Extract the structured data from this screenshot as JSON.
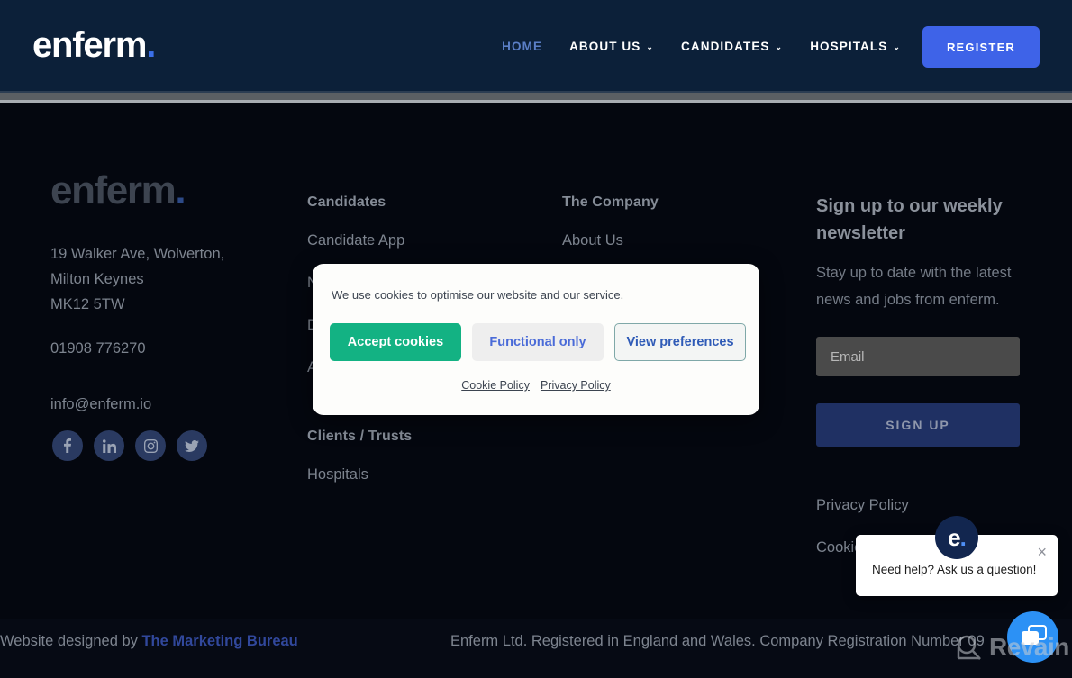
{
  "header": {
    "logo": "enferm",
    "logo_dot": ".",
    "nav": [
      {
        "label": "HOME",
        "caret": "",
        "active": true
      },
      {
        "label": "ABOUT US",
        "caret": "⌄",
        "active": false
      },
      {
        "label": "CANDIDATES",
        "caret": "⌄",
        "active": false
      },
      {
        "label": "HOSPITALS",
        "caret": "⌄",
        "active": false
      }
    ],
    "register_label": "REGISTER"
  },
  "footer": {
    "logo": "enferm",
    "logo_dot": ".",
    "address": "19 Walker Ave, Wolverton,\nMilton Keynes\nMK12 5TW",
    "phone": "01908 776270",
    "email": "info@enferm.io",
    "socials": [
      {
        "name": "facebook-icon"
      },
      {
        "name": "linkedin-icon"
      },
      {
        "name": "instagram-icon"
      },
      {
        "name": "twitter-icon"
      }
    ],
    "columns": {
      "candidates": {
        "title": "Candidates",
        "links": [
          "Candidate App",
          "Nurses",
          "Doctors",
          "AHP"
        ]
      },
      "company": {
        "title": "The Company",
        "links": [
          "About Us"
        ]
      },
      "clients": {
        "title": "Clients / Trusts",
        "links": [
          "Hospitals"
        ]
      }
    },
    "newsletter": {
      "title": "Sign up to our weekly newsletter",
      "body": "Stay up to date with the latest news and jobs from enferm.",
      "email_placeholder": "Email",
      "email_value": "",
      "signup_label": "SIGN UP"
    },
    "legal": [
      "Privacy Policy",
      "Cookie Policy"
    ]
  },
  "bottom_bar": {
    "designed_prefix": "Website designed by ",
    "designer": "The Marketing Bureau",
    "registration": "Enferm Ltd. Registered in England and Wales. Company Registration Number 09"
  },
  "cookie_dialog": {
    "message": "We use cookies to optimise our website and our service.",
    "buttons": {
      "accept": "Accept cookies",
      "functional": "Functional only",
      "preferences": "View preferences"
    },
    "links": [
      "Cookie Policy",
      "Privacy Policy"
    ],
    "colors": {
      "accept_bg": "#13b283",
      "functional_bg": "#eeeeee",
      "link_color": "#2f5bb7"
    }
  },
  "chat_widget": {
    "avatar_letter": "e",
    "avatar_dot": ".",
    "message": "Need help? Ask us a question!",
    "close_icon": "×"
  },
  "watermark": {
    "text": "Revain"
  },
  "colors": {
    "header_bg": "#0c2039",
    "page_bg": "#04070f",
    "accent_blue": "#3e63e8",
    "nav_active": "#5b7fc7"
  }
}
